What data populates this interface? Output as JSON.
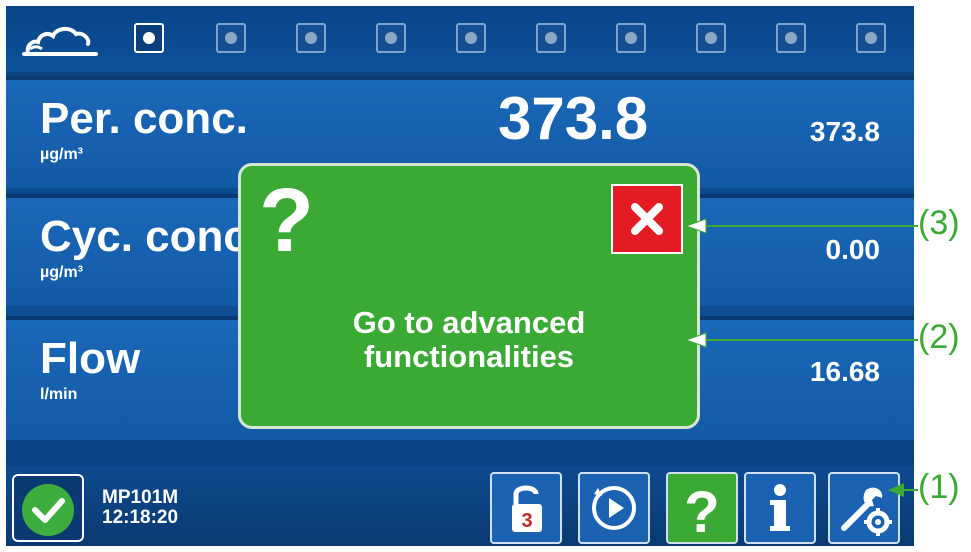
{
  "status_dots": [
    {
      "active": true
    },
    {
      "active": false
    },
    {
      "active": false
    },
    {
      "active": false
    },
    {
      "active": false
    },
    {
      "active": false
    },
    {
      "active": false
    },
    {
      "active": false
    },
    {
      "active": false
    },
    {
      "active": false
    }
  ],
  "measurements": [
    {
      "label": "Per. conc.",
      "unit": "µg/m³",
      "big_value": "373.8",
      "small_value": "373.8"
    },
    {
      "label": "Cyc. conc",
      "unit": "µg/m³",
      "small_value": "0.00"
    },
    {
      "label": "Flow",
      "unit": "l/min",
      "small_value": "16.68"
    }
  ],
  "device": {
    "name": "MP101M",
    "time": "12:18:20"
  },
  "bottom_buttons": {
    "lock_badge": "3"
  },
  "dialog": {
    "message": "Go to advanced functionalities"
  },
  "callouts": {
    "c1": "(1)",
    "c2": "(2)",
    "c3": "(3)"
  },
  "colors": {
    "accent_green": "#3aaa35",
    "close_red": "#e41b23",
    "screen_blue": "#1b62b3"
  },
  "icons": [
    "cloud-icon",
    "check-icon",
    "lock-icon",
    "play-icon",
    "help-icon",
    "info-icon",
    "settings-icon",
    "close-icon"
  ]
}
